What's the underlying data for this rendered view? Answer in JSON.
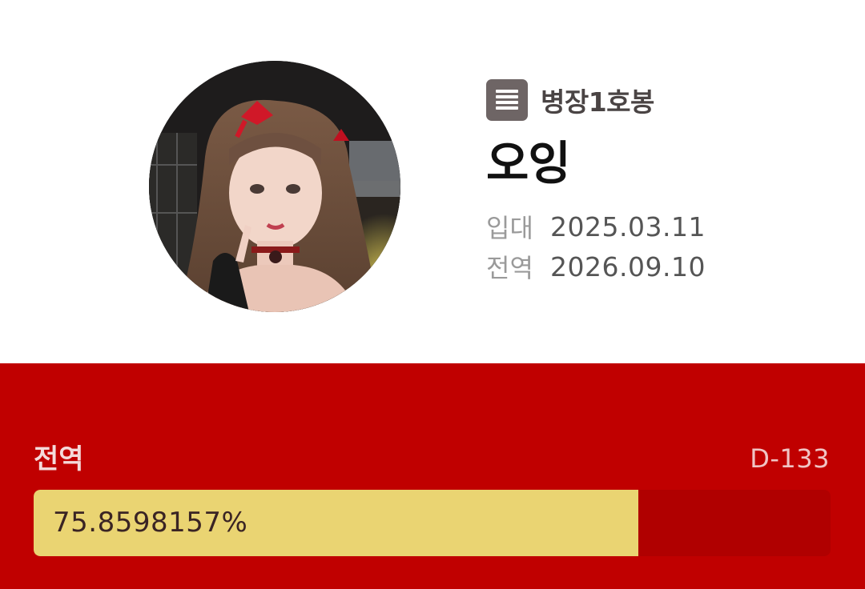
{
  "profile": {
    "rank": "병장1호봉",
    "name": "오잉",
    "enlist_label": "입대",
    "enlist_date": "2025.03.11",
    "discharge_label": "전역",
    "discharge_date": "2026.09.10",
    "rank_icon": "list-icon",
    "avatar": "profile-photo"
  },
  "progress": {
    "label": "전역",
    "dday": "D-133",
    "percent_text": "75.8598157%",
    "fraction": 0.758598157
  },
  "colors": {
    "accent_red": "#c00000",
    "track_red": "#b00000",
    "fill_yellow": "#ead472",
    "rank_icon_bg": "#6e6565"
  }
}
